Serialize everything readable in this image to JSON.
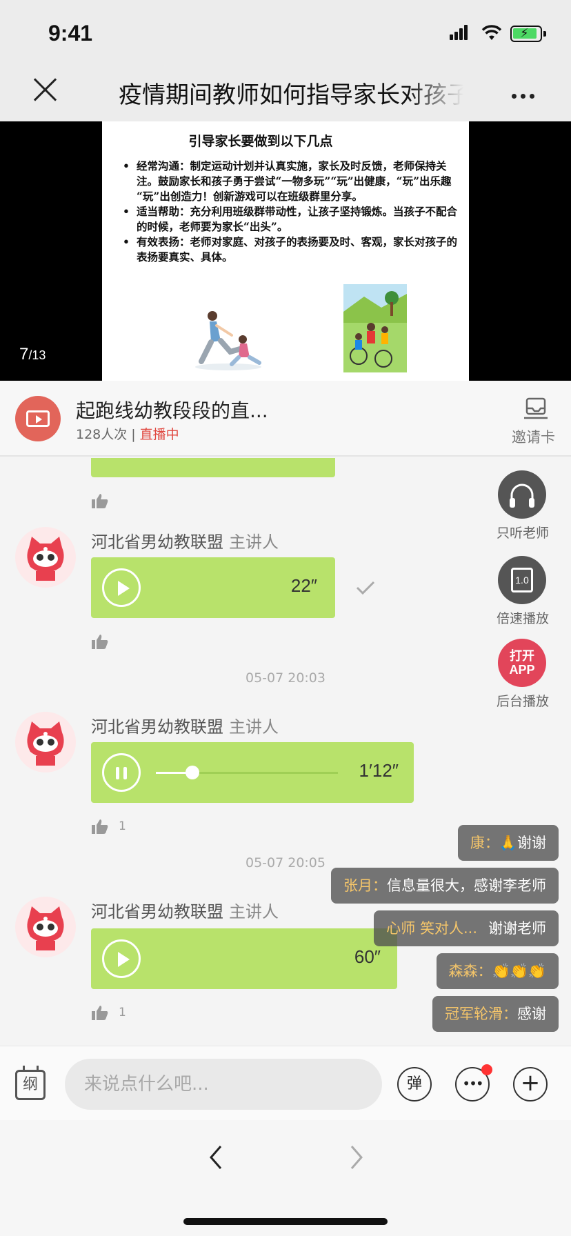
{
  "status_bar": {
    "time": "9:41"
  },
  "nav": {
    "title": "疫情期间教师如何指导家长对孩子"
  },
  "slide": {
    "title": "引导家长要做到以下几点",
    "bullets": [
      "经常沟通：制定运动计划并认真实施，家长及时反馈，老师保持关注。鼓励家长和孩子勇于尝试“一物多玩”“玩”出健康，“玩”出乐趣 “玩”出创造力！创新游戏可以在班级群里分享。",
      "适当帮助：充分利用班级群带动性，让孩子坚持锻炼。当孩子不配合的时候，老师要为家长“出头”。",
      "有效表扬：老师对家庭、对孩子的表扬要及时、客观，家长对孩子的表扬要真实、具体。"
    ],
    "page_current": "7",
    "page_total": "/13"
  },
  "live": {
    "title": "起跑线幼教段段的直...",
    "viewers": "128人次",
    "separator": "|",
    "status": "直播中",
    "invite_label": "邀请卡",
    "status_color": "#e0463e"
  },
  "floating": {
    "listen_teacher": "只听老师",
    "speed_play": "倍速播放",
    "speed_value": "1.0",
    "open_app_line1": "打开",
    "open_app_line2": "APP",
    "background_play": "后台播放"
  },
  "messages": [
    {
      "speaker": "河北省男幼教联盟",
      "role": "主讲人",
      "duration": "22″",
      "likes": "",
      "state": "paused"
    },
    {
      "timestamp": "05-07 20:03",
      "speaker": "河北省男幼教联盟",
      "role": "主讲人",
      "duration": "1′12″",
      "likes": "1",
      "state": "playing",
      "progress": 0.2
    },
    {
      "timestamp": "05-07 20:05",
      "speaker": "河北省男幼教联盟",
      "role": "主讲人",
      "duration": "60″",
      "likes": "1",
      "state": "paused"
    }
  ],
  "danmaku": [
    {
      "name": "康：",
      "text": "🙏谢谢"
    },
    {
      "name": "张月：",
      "text": "信息量很大，感谢李老师"
    },
    {
      "name": "心师 笑对人...",
      "text": "谢谢老师"
    },
    {
      "name": "森森：",
      "text": "👏👏👏"
    },
    {
      "name": "冠军轮滑：",
      "text": "感谢"
    }
  ],
  "input_bar": {
    "calendar_glyph": "纲",
    "placeholder": "来说点什么吧...",
    "danmaku_btn": "弹"
  },
  "colors": {
    "bubble_green": "#b8e26b",
    "accent_red": "#e2455a"
  }
}
